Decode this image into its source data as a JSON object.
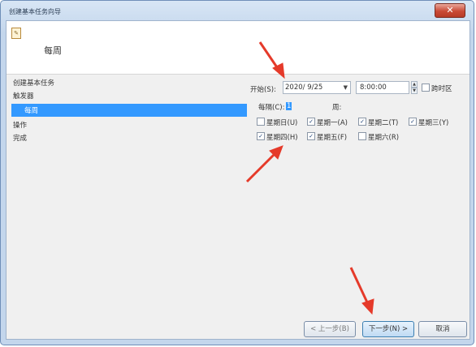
{
  "window": {
    "title": "创建基本任务向导",
    "close_symbol": "✕"
  },
  "header": {
    "icon": "wizard-icon",
    "title": "每周"
  },
  "nav": {
    "items": [
      {
        "label": "创建基本任务",
        "selected": false
      },
      {
        "label": "触发器",
        "selected": false
      },
      {
        "label": "每周",
        "selected": true
      },
      {
        "label": "操作",
        "selected": false
      },
      {
        "label": "完成",
        "selected": false
      }
    ]
  },
  "form": {
    "start_label": "开始(S):",
    "start_date": "2020/ 9/25",
    "start_time": "8:00:00",
    "sync_tz_label": "跨时区",
    "sync_tz_checked": false,
    "interval_label": "每隔(C):",
    "interval_value": "1",
    "interval_unit": "周:",
    "days": [
      {
        "label": "星期日(U)",
        "checked": false
      },
      {
        "label": "星期一(A)",
        "checked": true
      },
      {
        "label": "星期二(T)",
        "checked": true
      },
      {
        "label": "星期三(Y)",
        "checked": true
      },
      {
        "label": "星期四(H)",
        "checked": true
      },
      {
        "label": "星期五(F)",
        "checked": true
      },
      {
        "label": "星期六(R)",
        "checked": false
      }
    ]
  },
  "buttons": {
    "back": "< 上一步(B)",
    "next": "下一步(N) >",
    "cancel": "取消"
  },
  "accent_color": "#3399ff",
  "annotation_color": "#e53a2a"
}
